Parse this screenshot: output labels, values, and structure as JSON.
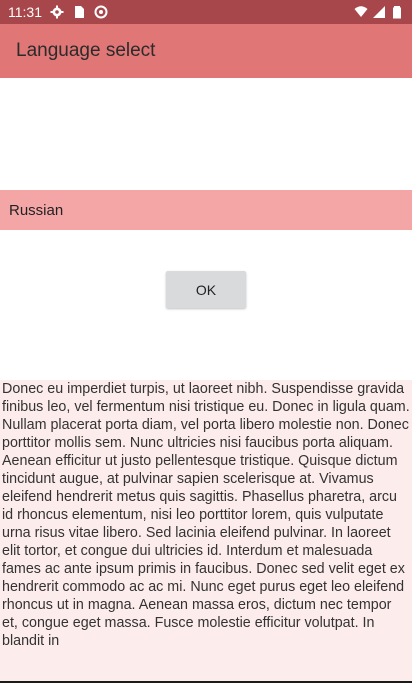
{
  "status_bar": {
    "time": "11:31",
    "icons_left": [
      "gear-icon",
      "sim-card-icon",
      "sync-icon"
    ],
    "icons_right": [
      "wifi-icon",
      "signal-icon",
      "battery-icon"
    ]
  },
  "app_bar": {
    "title": "Language select"
  },
  "language": {
    "selected": "Russian"
  },
  "button": {
    "ok_label": "OK"
  },
  "content": {
    "paragraph": "Donec eu imperdiet turpis, ut laoreet nibh. Suspendisse gravida finibus leo, vel fermentum nisi tristique eu. Donec in ligula quam. Nullam placerat porta diam, vel porta libero molestie non. Donec porttitor mollis sem. Nunc ultricies nisi faucibus porta aliquam. Aenean efficitur ut justo pellentesque tristique. Quisque dictum tincidunt augue, at pulvinar sapien scelerisque at. Vivamus eleifend hendrerit metus quis sagittis. Phasellus pharetra, arcu id rhoncus elementum, nisi leo porttitor lorem, quis vulputate urna risus vitae libero. Sed lacinia eleifend pulvinar. In laoreet elit tortor, et congue dui ultricies id. Interdum et malesuada fames ac ante ipsum primis in faucibus. Donec sed velit eget ex hendrerit commodo ac ac mi. Nunc eget purus eget leo eleifend rhoncus ut in magna. Aenean massa eros, dictum nec tempor et, congue eget massa. Fusce molestie efficitur volutpat. In blandit in"
  },
  "colors": {
    "status_bar": "#a8474b",
    "app_bar": "#e17677",
    "selected_row": "#f4a6a6",
    "text_panel": "#fdecec",
    "button": "#d8dadb"
  }
}
